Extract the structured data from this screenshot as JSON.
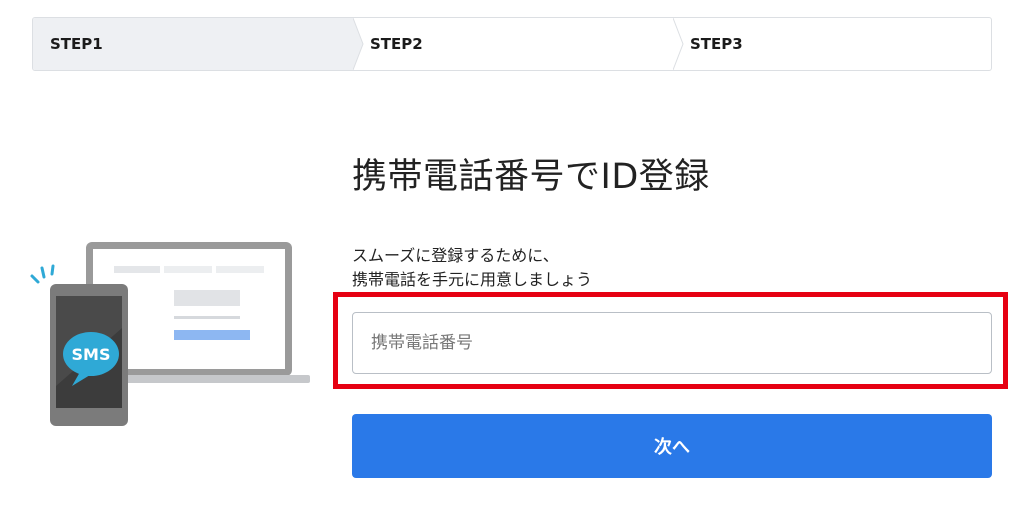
{
  "steps": [
    {
      "label": "STEP1",
      "active": true
    },
    {
      "label": "STEP2",
      "active": false
    },
    {
      "label": "STEP3",
      "active": false
    }
  ],
  "page": {
    "title": "携帯電話番号でID登録",
    "description_line1": "スムーズに登録するために、",
    "description_line2": "携帯電話を手元に用意しましょう"
  },
  "form": {
    "phone_placeholder": "携帯電話番号",
    "phone_value": "",
    "next_label": "次へ"
  },
  "illustration": {
    "badge_text": "SMS",
    "icons": [
      "laptop-icon",
      "smartphone-icon",
      "sms-bubble-icon",
      "notification-lines-icon"
    ]
  },
  "colors": {
    "primary": "#2a79e8",
    "highlight": "#e60012",
    "active_step_bg": "#eef0f3",
    "sms_bubble": "#2fa9d6"
  }
}
